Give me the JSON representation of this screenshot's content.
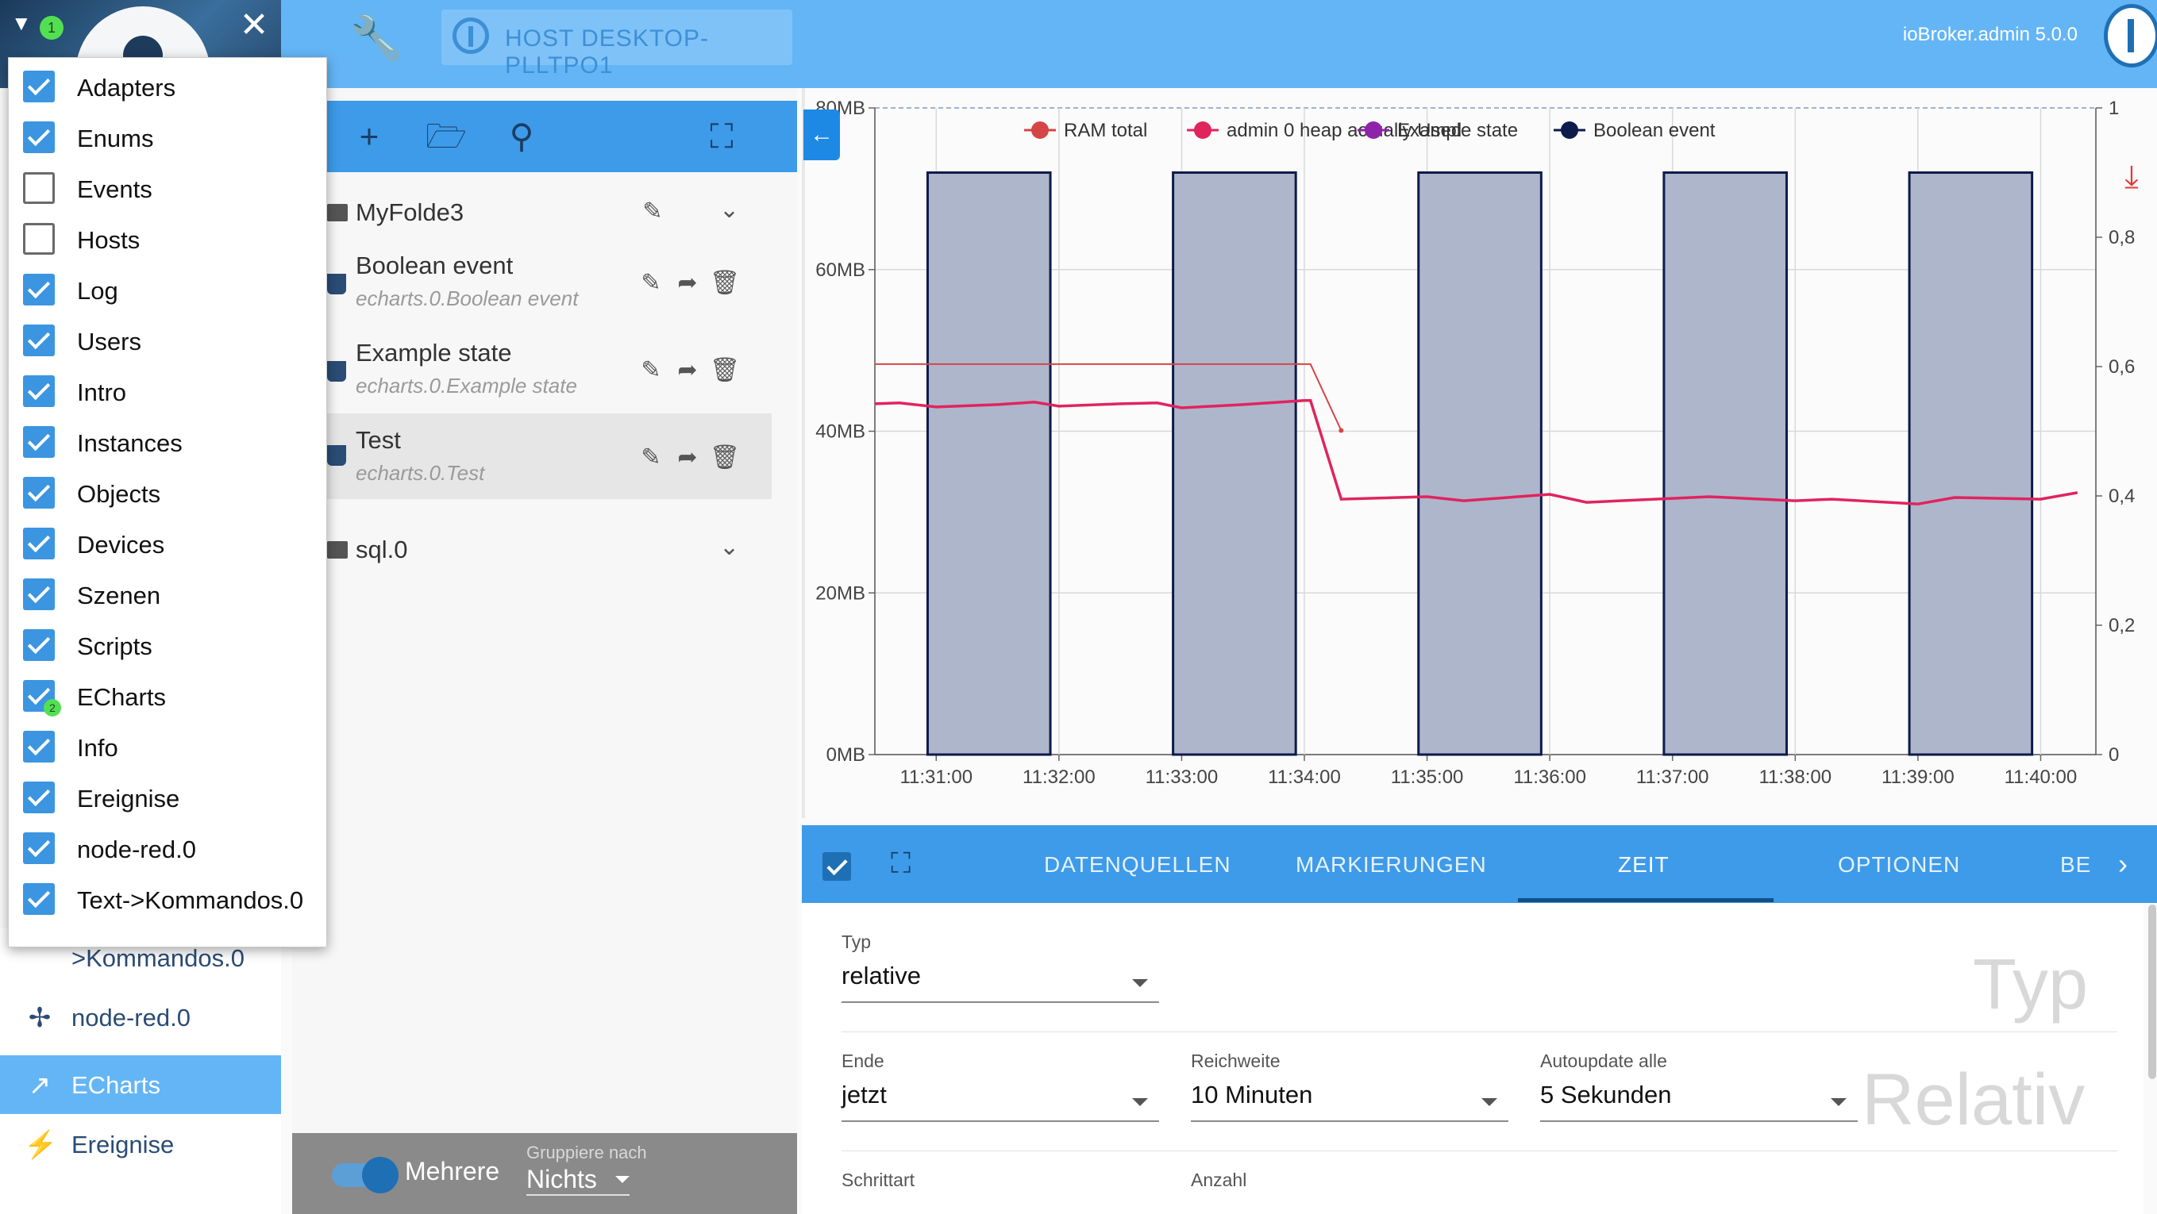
{
  "header": {
    "host_text": "HOST DESKTOP-PLLTPO1",
    "admin_version": "ioBroker.admin 5.0.0",
    "menu_badge": "1"
  },
  "menu_dropdown": {
    "items": [
      {
        "label": "Adapters",
        "checked": true
      },
      {
        "label": "Enums",
        "checked": true
      },
      {
        "label": "Events",
        "checked": false
      },
      {
        "label": "Hosts",
        "checked": false
      },
      {
        "label": "Log",
        "checked": true
      },
      {
        "label": "Users",
        "checked": true
      },
      {
        "label": "Intro",
        "checked": true
      },
      {
        "label": "Instances",
        "checked": true
      },
      {
        "label": "Objects",
        "checked": true
      },
      {
        "label": "Devices",
        "checked": true
      },
      {
        "label": "Szenen",
        "checked": true
      },
      {
        "label": "Scripts",
        "checked": true
      },
      {
        "label": "ECharts",
        "checked": true,
        "badge": "2"
      },
      {
        "label": "Info",
        "checked": true
      },
      {
        "label": "Ereignise",
        "checked": true
      },
      {
        "label": "node-red.0",
        "checked": true
      },
      {
        "label": "Text->Kommandos.0",
        "checked": true
      }
    ]
  },
  "sidebar": {
    "items": [
      {
        "label": ">Kommandos.0",
        "icon": "none"
      },
      {
        "label": "node-red.0",
        "icon": "node-red-icon"
      },
      {
        "label": "ECharts",
        "icon": "chart-line-icon",
        "active": true
      },
      {
        "label": "Ereignise",
        "icon": "flash-icon"
      }
    ]
  },
  "objects": {
    "rows": [
      {
        "title": "MyFolde3",
        "type": "folder"
      },
      {
        "title": "Boolean event",
        "subtitle": "echarts.0.Boolean event",
        "type": "state"
      },
      {
        "title": "Example state",
        "subtitle": "echarts.0.Example state",
        "type": "state"
      },
      {
        "title": "Test",
        "subtitle": "echarts.0.Test",
        "type": "state",
        "selected": true
      },
      {
        "title": "sql.0",
        "type": "folder"
      }
    ],
    "footer": {
      "toggle_label": "Mehrere",
      "group_label": "Gruppiere nach",
      "group_value": "Nichts"
    }
  },
  "chart_data": {
    "type": "line",
    "x_ticks": [
      "11:31:00",
      "11:32:00",
      "11:33:00",
      "11:34:00",
      "11:35:00",
      "11:36:00",
      "11:37:00",
      "11:38:00",
      "11:39:00",
      "11:40:00"
    ],
    "y_left_ticks": [
      "0MB",
      "20MB",
      "40MB",
      "60MB",
      "80MB"
    ],
    "y_left_range_mb": [
      0,
      80
    ],
    "y_right_ticks": [
      "0",
      "0,2",
      "0,4",
      "0,6",
      "0,8",
      "1"
    ],
    "y_right_range": [
      0,
      1
    ],
    "legend": [
      {
        "name": "RAM total",
        "color": "#d64545"
      },
      {
        "name": "admin 0 heap actually Used",
        "color": "#e0245e"
      },
      {
        "name": "Example state",
        "color": "#8e24aa"
      },
      {
        "name": "Boolean event",
        "color": "#0d1b4a"
      }
    ],
    "series": [
      {
        "name": "RAM total",
        "axis": "left",
        "x_min": [
          30.5,
          34.05,
          34.3
        ],
        "y_mb": [
          48.3,
          48.3,
          40.1
        ]
      },
      {
        "name": "admin 0 heap actually Used",
        "axis": "left",
        "x_min": [
          30.5,
          30.7,
          31.0,
          31.5,
          31.8,
          32.0,
          32.5,
          32.8,
          33.0,
          33.5,
          34.0,
          34.05,
          34.3,
          35.0,
          35.3,
          36.0,
          36.3,
          37.0,
          37.3,
          38.0,
          38.3,
          39.0,
          39.3,
          40.0,
          40.3
        ],
        "y_mb": [
          43.4,
          43.5,
          43.0,
          43.3,
          43.6,
          43.1,
          43.4,
          43.5,
          42.9,
          43.3,
          43.8,
          43.8,
          31.6,
          31.9,
          31.4,
          32.2,
          31.2,
          31.7,
          31.9,
          31.4,
          31.6,
          31.0,
          31.8,
          31.6,
          32.4
        ]
      },
      {
        "name": "Boolean event",
        "axis": "right",
        "type": "area",
        "pulses_min": [
          [
            30.93,
            31.93
          ],
          [
            32.93,
            33.93
          ],
          [
            34.93,
            35.93
          ],
          [
            36.93,
            37.93
          ],
          [
            38.93,
            39.93
          ]
        ],
        "high": 0.9,
        "low": 0
      }
    ],
    "x_range_min": [
      30.5,
      40.45
    ],
    "grid": true,
    "legend_position": "top-right"
  },
  "settings": {
    "tabs": [
      {
        "label": "DATENQUELLEN"
      },
      {
        "label": "MARKIERUNGEN"
      },
      {
        "label": "ZEIT",
        "active": true
      },
      {
        "label": "OPTIONEN"
      },
      {
        "label": "BE"
      }
    ],
    "form": {
      "typ_label": "Typ",
      "typ_value": "relative",
      "ende_label": "Ende",
      "ende_value": "jetzt",
      "reichweite_label": "Reichweite",
      "reichweite_value": "10 Minuten",
      "autoupdate_label": "Autoupdate alle",
      "autoupdate_value": "5 Sekunden",
      "schrittart_label": "Schrittart",
      "anzahl_label": "Anzahl",
      "ghost_typ": "Typ",
      "ghost_relativ": "Relativ"
    }
  }
}
